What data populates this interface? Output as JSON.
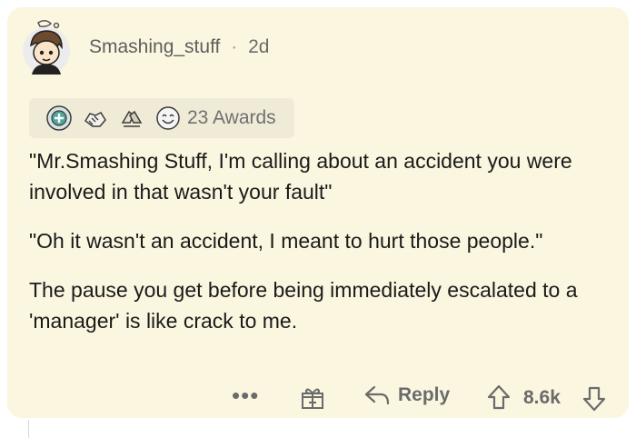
{
  "comment": {
    "author": "Smashing_stuff",
    "separator": "·",
    "age": "2d",
    "awards": {
      "count_label": "23 Awards",
      "icons": [
        "helpful-award-icon",
        "wholesome-handshake-icon",
        "hands-award-icon",
        "smile-award-icon"
      ]
    },
    "paragraphs": [
      "\"Mr.Smashing Stuff, I'm calling about an accident you were involved in that wasn't your fault\"",
      "\"Oh it wasn't an accident, I meant to hurt those people.\"",
      "The pause you get before being immediately escalated to a 'manager' is like crack to me."
    ]
  },
  "actions": {
    "more_label": "•••",
    "reply_label": "Reply",
    "score": "8.6k"
  }
}
